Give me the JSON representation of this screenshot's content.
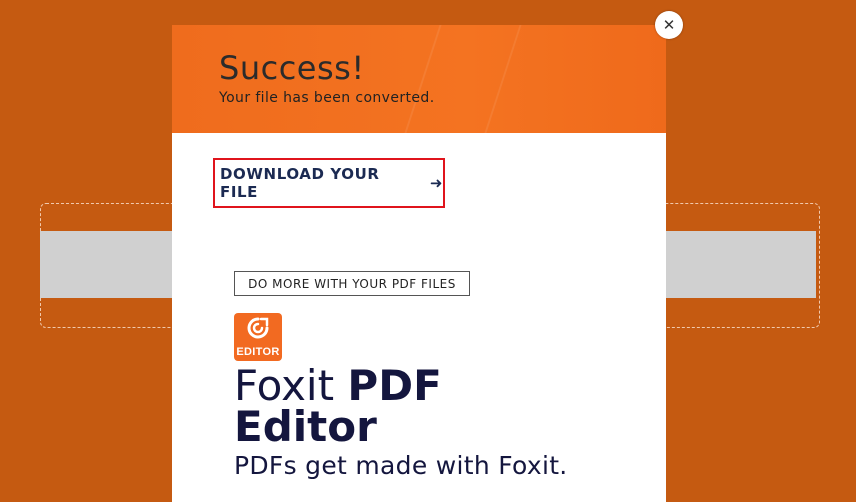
{
  "modal": {
    "title": "Success!",
    "subtitle": "Your file has been converted.",
    "download_label": "DOWNLOAD YOUR FILE",
    "download_arrow": "➜",
    "promo_badge": "DO MORE WITH YOUR PDF FILES",
    "logo_text": "EDITOR",
    "product_name_light": "Foxit ",
    "product_name_bold_1": "PDF",
    "product_name_bold_2": "Editor",
    "tagline": "PDFs get made with Foxit.",
    "close_symbol": "✕"
  },
  "colors": {
    "page_background": "#c55a11",
    "header_orange": "#f47321",
    "download_border": "#e0141c",
    "heading_navy": "#14163e"
  },
  "icons": {
    "close": "close-icon",
    "arrow": "arrow-right-icon",
    "logo": "foxit-logo-icon"
  }
}
